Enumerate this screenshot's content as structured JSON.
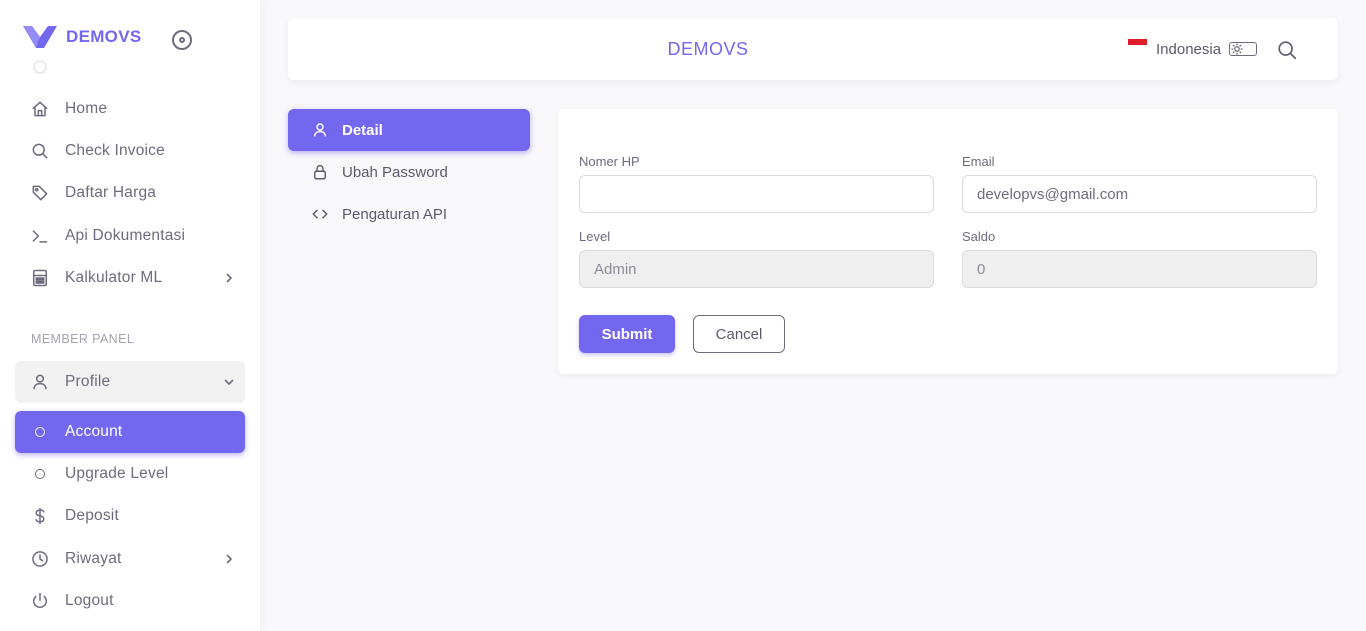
{
  "brand": {
    "name": "DEMOVS"
  },
  "sidebar": {
    "items": [
      {
        "label": "Home",
        "icon": "home-icon"
      },
      {
        "label": "Check Invoice",
        "icon": "search-icon"
      },
      {
        "label": "Daftar Harga",
        "icon": "tag-icon"
      },
      {
        "label": "Api Dokumentasi",
        "icon": "terminal-icon"
      },
      {
        "label": "Kalkulator ML",
        "icon": "calculator-icon"
      }
    ],
    "section_header": "MEMBER PANEL",
    "member_items": [
      {
        "label": "Profile",
        "icon": "user-icon"
      },
      {
        "label": "Account",
        "icon": "circle-icon"
      },
      {
        "label": "Upgrade Level",
        "icon": "circle-icon"
      },
      {
        "label": "Deposit",
        "icon": "dollar-icon"
      },
      {
        "label": "Riwayat",
        "icon": "clock-icon"
      },
      {
        "label": "Logout",
        "icon": "power-icon"
      }
    ]
  },
  "navbar": {
    "title": "DEMOVS",
    "language": "Indonesia"
  },
  "tabs": [
    {
      "label": "Detail",
      "icon": "user-icon"
    },
    {
      "label": "Ubah Password",
      "icon": "lock-icon"
    },
    {
      "label": "Pengaturan API",
      "icon": "code-icon"
    }
  ],
  "form": {
    "phone_label": "Nomer HP",
    "phone_value": "",
    "email_label": "Email",
    "email_value": "developvs@gmail.com",
    "level_label": "Level",
    "level_value": "Admin",
    "saldo_label": "Saldo",
    "saldo_value": "0",
    "submit_label": "Submit",
    "cancel_label": "Cancel"
  },
  "colors": {
    "accent": "#7367f0",
    "text": "#5d596c",
    "background": "#f8f7fa"
  }
}
